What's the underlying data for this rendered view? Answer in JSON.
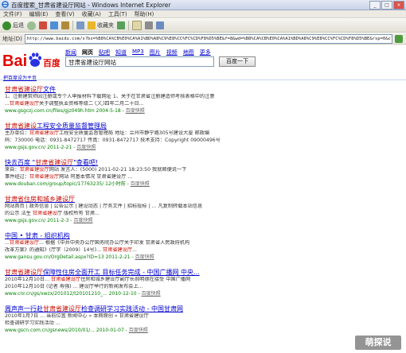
{
  "window": {
    "title": "百度搜索_甘肃省建设厅网站 - Windows Internet Explorer"
  },
  "menubar": {
    "items": [
      "文件(F)",
      "编辑(E)",
      "查看(V)",
      "收藏(A)",
      "工具(T)",
      "帮助(H)"
    ]
  },
  "toolbar": {
    "back_label": "后退",
    "favorites_label": "收藏夹"
  },
  "addressbar": {
    "label": "地址(D)",
    "url": "http://www.baidu.com/s?bs=%B8%CA%CB%E0%CA%A1%BD%A8%C9%E8%CC%FC%CD%F8%D5%BE&f=8&wd=%B8%CA%CB%E0%CA%A1%BD%A8%C9%E8%CC%FC%CD%F8%D5%BE&rsp=0&cl=3"
  },
  "search": {
    "tabs": [
      "新闻",
      "网页",
      "贴吧",
      "知道",
      "MP3",
      "图片",
      "视频",
      "地图",
      "更多"
    ],
    "active_tab_index": 1,
    "query": "甘肃省建设厅网站",
    "button_label": "百度一下",
    "home_link": "把百度设为主页"
  },
  "results": [
    {
      "title_pre": "",
      "title_em": "甘肃省建设厅",
      "title_post": "文件",
      "snippet1_pre": "1、注册建筑师因注册或专",
      "snippet1_em": "",
      "snippet1_post": "个人申报材料下载网址 1、关于在甘肃省注册建造师考核表格中的注意",
      "snippet2_pre": "...",
      "snippet2_em": "甘肃省建设厅",
      "snippet2_post": "关于调整执业资格等级二 〇〇四年二月二十日...",
      "url": "www.gsgczj.com.cn/files/gjz049h.htm 2004-5-18",
      "snapshot": "百度快照"
    },
    {
      "title_pre": "",
      "title_em": "甘肃省建设",
      "title_post": "工程安全质量监督管理局",
      "snippet1_pre": "主办单位：",
      "snippet1_em": "甘肃省建设厅",
      "snippet1_post": "工程安全质量监督管理局 地址：兰州市静宁路305号建设大厦 邮政编",
      "snippet2_pre": "码：730000 电话：0931-8472717 传真：0931-8472717 技术支持：",
      "snippet2_em": "",
      "snippet2_post": "Copyright 09000496号",
      "url": "www.gsjs.gov.cn/ 2011-2-21",
      "snapshot": "百度快照"
    },
    {
      "title_pre": "快去百度 \"",
      "title_em": "甘肃省建设厅",
      "title_post": "\"查看吧!",
      "snippet1_pre": "来自：",
      "snippet1_em": "甘肃省建设厅",
      "snippet1_post": "网站 发言人：(5000) 2011-02-21 18:23:50 我就顺便说一下",
      "snippet2_pre": "事件经过：",
      "snippet2_em": "甘肃省建设厅",
      "snippet2_post": "网站 阿基本情况 甘肃省建设厅 ...",
      "url": "www.douban.com/group/topic/17763235/ 12小时前",
      "snapshot": "百度快照"
    },
    {
      "title_pre": "",
      "title_em": "甘肃省住房和城乡建设厅",
      "title_post": "",
      "snippet1_pre": "网站首页 | 政务信息 | 公告公示 | 建设动态 | 厅务文件 | 招标投标 | ... 凡复制转载本站信息",
      "snippet1_em": "",
      "snippet1_post": "",
      "snippet2_pre": "的公示 法生 ",
      "snippet2_em": "甘肃省建设",
      "snippet2_post": "厅 版权所有 甘肃...",
      "url": "www.gsjs.gov.cn/ 2011-2-3",
      "snapshot": "百度快照"
    },
    {
      "title_pre": "中国 • 甘肃 - 组织机构",
      "title_em": "",
      "title_post": "",
      "snippet1_pre": "...",
      "snippet1_em": "甘肃省建设厅",
      "snippet1_post": "... 根据《中共中央办公厅国务院办公厅关于印发 甘肃省人民政府机构",
      "snippet2_pre": "改革方案》的通知》(厅字〔2009〕14号)... ",
      "snippet2_em": "甘肃省建设厅",
      "snippet2_post": "...",
      "url": "www.gansu.gov.cn/OrgDetail.aspx?ID=13 2011-2-21",
      "snapshot": "百度快照"
    },
    {
      "title_pre": "",
      "title_em": "甘肃省建设厅",
      "title_post": "保障性住房全面开工 目标任务完成 - 中国广播网 中央...",
      "snippet1_pre": "2010年12月10日... ",
      "snippet1_em": "甘肃省建设厅",
      "snippet1_post": "住房和城乡建设厅副厅长郝明德在接受 中国广播网",
      "snippet2_pre": "2010年12月10日 (记者 ",
      "snippet2_em": "",
      "snippet2_post": "寿强) ... 建设厅举行的新闻发布会上...",
      "url": "www.cnr.cn/gs/xwzx/201012/t20101210_... 2010-12-10",
      "snapshot": "百度快照"
    },
    {
      "title_pre": "周声声一行赴",
      "title_em": "甘肃省建设厅",
      "title_post": "检查调研学习实践活动 - 中国甘肃网",
      "snippet1_pre": "2010年1月7日 ... 当前位置 ",
      "snippet1_em": "",
      "snippet1_post": "新闻中心 » 本网原创 » 甘肃省建设厅",
      "snippet2_pre": "检查调研学习实践活动 ...",
      "snippet2_em": "",
      "snippet2_post": "",
      "url": "www.gscn.com.cn/gsnews/2010/01/... 2010-01-07",
      "snapshot": "百度快照"
    }
  ],
  "watermark": "萌探说"
}
